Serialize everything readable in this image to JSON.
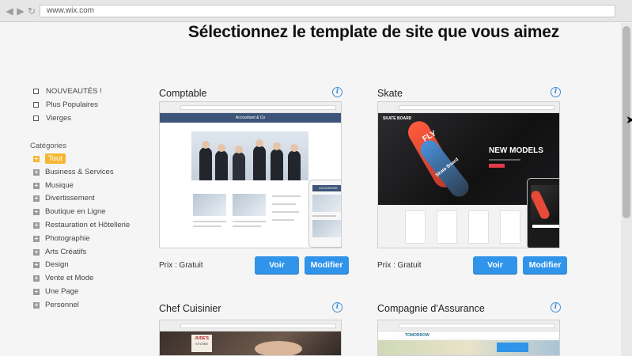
{
  "browser": {
    "url": "www.wix.com"
  },
  "headline": "Sélectionnez le template de site que vous aimez",
  "sidebar": {
    "filters": [
      "NOUVEAUTÉS !",
      "Plus Populaires",
      "Vierges"
    ],
    "categories_title": "Catégories",
    "categories": [
      "Tout",
      "Business & Services",
      "Musique",
      "Divertissement",
      "Boutique en Ligne",
      "Restauration et Hôtellerie",
      "Photographie",
      "Arts Créatifs",
      "Design",
      "Vente et Mode",
      "Une Page",
      "Personnel"
    ],
    "active_category": "Tout"
  },
  "templates": [
    {
      "name": "Comptable",
      "price": "Prix : Gratuit",
      "view_label": "Voir",
      "edit_label": "Modifier",
      "preview": {
        "header": "Accountant & Co",
        "mobile_header": "ACCOUNTING"
      }
    },
    {
      "name": "Skate",
      "price": "Prix : Gratuit",
      "view_label": "Voir",
      "edit_label": "Modifier",
      "preview": {
        "brand": "SKATE BOARD",
        "headline": "NEW MODELS",
        "board_text": "Skate Board",
        "fly": "FLY"
      }
    },
    {
      "name": "Chef Cuisinier",
      "preview": {
        "brand": "JUDE'S",
        "sub": "KITCHEN"
      }
    },
    {
      "name": "Compagnie d'Assurance",
      "preview": {
        "brand": "TOMORROW"
      }
    }
  ],
  "info_icon_glyph": "i",
  "colors": {
    "accent": "#2f94ea",
    "active_category": "#f5b731"
  }
}
